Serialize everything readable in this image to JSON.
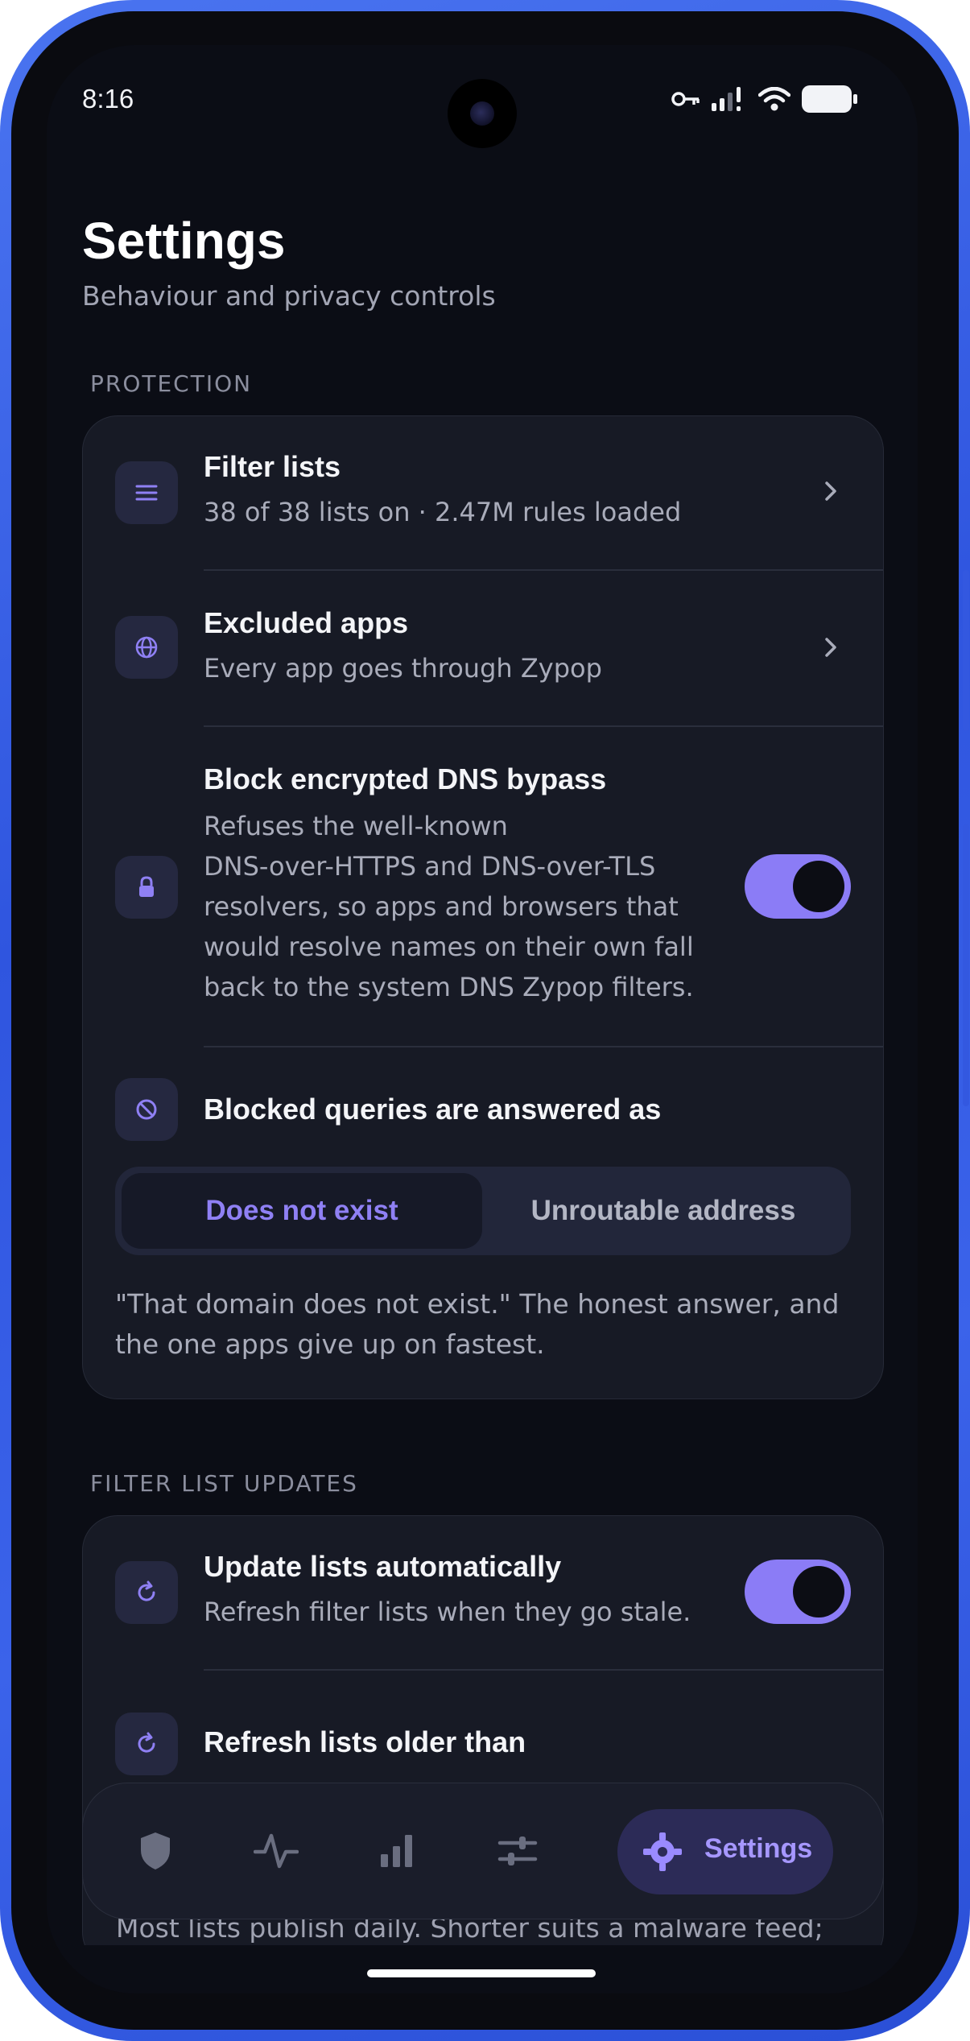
{
  "status_bar": {
    "time": "8:16",
    "icons": [
      "vpn-key-icon",
      "signal-icon",
      "wifi-icon",
      "battery-icon"
    ]
  },
  "header": {
    "title": "Settings",
    "subtitle": "Behaviour and privacy controls"
  },
  "protection": {
    "section_label": "PROTECTION",
    "filter_lists": {
      "title": "Filter lists",
      "subtitle": "38 of 38 lists on · 2.47M rules loaded",
      "icon": "list-icon"
    },
    "excluded_apps": {
      "title": "Excluded apps",
      "subtitle": "Every app goes through Zypop",
      "icon": "globe-icon"
    },
    "block_encrypted_dns": {
      "title": "Block encrypted DNS bypass",
      "description_lines": [
        "Refuses the well-known",
        "DNS-over-HTTPS and DNS-over-TLS",
        "resolvers, so apps and browsers that",
        "would resolve names on their own fall",
        "back to the system DNS Zypop filters."
      ],
      "enabled": true,
      "icon": "lock-icon"
    },
    "blocked_queries": {
      "title": "Blocked queries are answered as",
      "icon": "blocked-icon",
      "options": [
        "Does not exist",
        "Unroutable address"
      ],
      "selected": "Does not exist",
      "note_lines": [
        "\"That domain does not exist.\" The honest answer, and",
        "the one apps give up on fastest."
      ]
    }
  },
  "updates": {
    "section_label": "FILTER LIST UPDATES",
    "auto_update": {
      "title": "Update lists automatically",
      "subtitle": "Refresh filter lists when they go stale.",
      "enabled": true,
      "icon": "refresh-icon"
    },
    "refresh_older": {
      "title": "Refresh lists older than",
      "icon": "refresh-icon"
    },
    "footer_text": "Most lists publish daily. Shorter suits a malware feed;"
  },
  "bottom_nav": {
    "items": [
      "shield-icon",
      "activity-icon",
      "stats-icon",
      "sliders-icon"
    ],
    "active_label": "Settings",
    "active_icon": "settings-icon"
  },
  "colors": {
    "accent": "#8b7cf6",
    "frame": "#3358e0",
    "background": "#0b0d15",
    "card": "#171a25"
  }
}
